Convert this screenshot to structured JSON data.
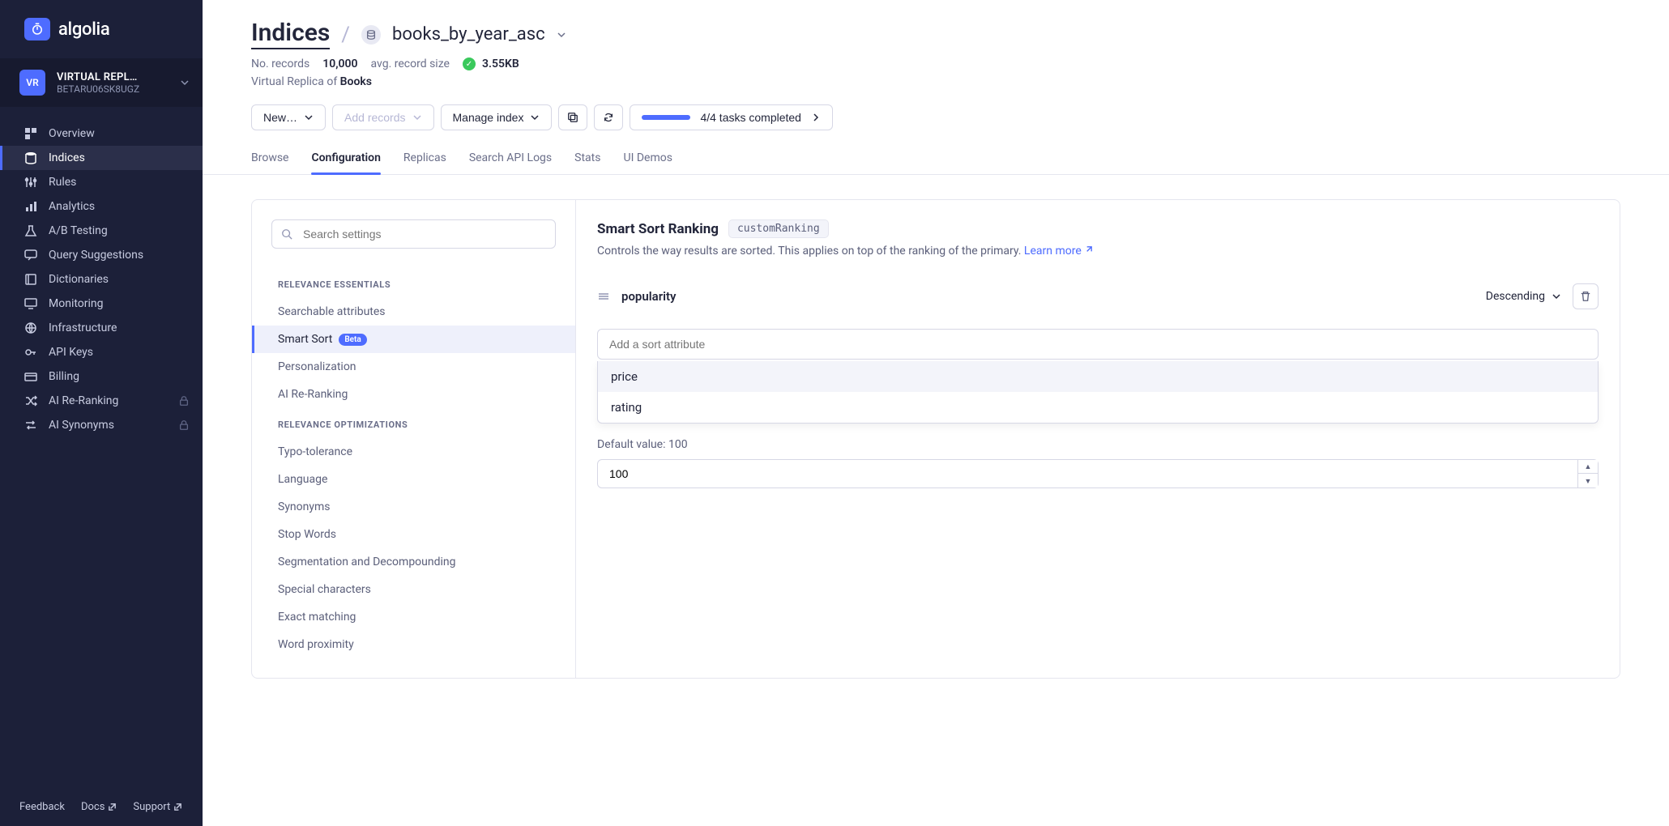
{
  "brand": "algolia",
  "app_switcher": {
    "avatar": "VR",
    "name": "VIRTUAL REPL…",
    "id": "BETARU06SK8UGZ"
  },
  "nav": {
    "overview": "Overview",
    "indices": "Indices",
    "rules": "Rules",
    "analytics": "Analytics",
    "ab_testing": "A/B Testing",
    "query_suggestions": "Query Suggestions",
    "dictionaries": "Dictionaries",
    "monitoring": "Monitoring",
    "infrastructure": "Infrastructure",
    "api_keys": "API Keys",
    "billing": "Billing",
    "ai_reranking": "AI Re-Ranking",
    "ai_synonyms": "AI Synonyms"
  },
  "footer": {
    "feedback": "Feedback",
    "docs": "Docs",
    "support": "Support"
  },
  "breadcrumb": {
    "root": "Indices",
    "index": "books_by_year_asc"
  },
  "stats": {
    "records_label": "No. records",
    "records_value": "10,000",
    "avg_label": "avg. record size",
    "avg_value": "3.55KB"
  },
  "replica": {
    "prefix": "Virtual Replica of ",
    "primary": "Books"
  },
  "toolbar": {
    "new": "New…",
    "add_records": "Add records",
    "manage_index": "Manage index",
    "tasks": "4/4 tasks completed"
  },
  "tabs": {
    "browse": "Browse",
    "configuration": "Configuration",
    "replicas": "Replicas",
    "search_api_logs": "Search API Logs",
    "stats": "Stats",
    "ui_demos": "UI Demos"
  },
  "settings_search": {
    "placeholder": "Search settings"
  },
  "sections": {
    "relevance_essentials": "RELEVANCE ESSENTIALS",
    "relevance_optimizations": "RELEVANCE OPTIMIZATIONS"
  },
  "settings": {
    "searchable_attributes": "Searchable attributes",
    "smart_sort": "Smart Sort",
    "smart_sort_badge": "Beta",
    "personalization": "Personalization",
    "ai_reranking": "AI Re-Ranking",
    "typo_tolerance": "Typo-tolerance",
    "language": "Language",
    "synonyms": "Synonyms",
    "stop_words": "Stop Words",
    "segmentation": "Segmentation and Decompounding",
    "special_characters": "Special characters",
    "exact_matching": "Exact matching",
    "word_proximity": "Word proximity"
  },
  "right": {
    "title": "Smart Sort Ranking",
    "code": "customRanking",
    "desc": "Controls the way results are sorted. This applies on top of the ranking of the primary. ",
    "learn_more": "Learn more",
    "sort_attr": "popularity",
    "order": "Descending",
    "add_placeholder": "Add a sort attribute",
    "options": {
      "opt1": "price",
      "opt2": "rating"
    },
    "default_label": "Default value: 100",
    "default_value": "100"
  }
}
